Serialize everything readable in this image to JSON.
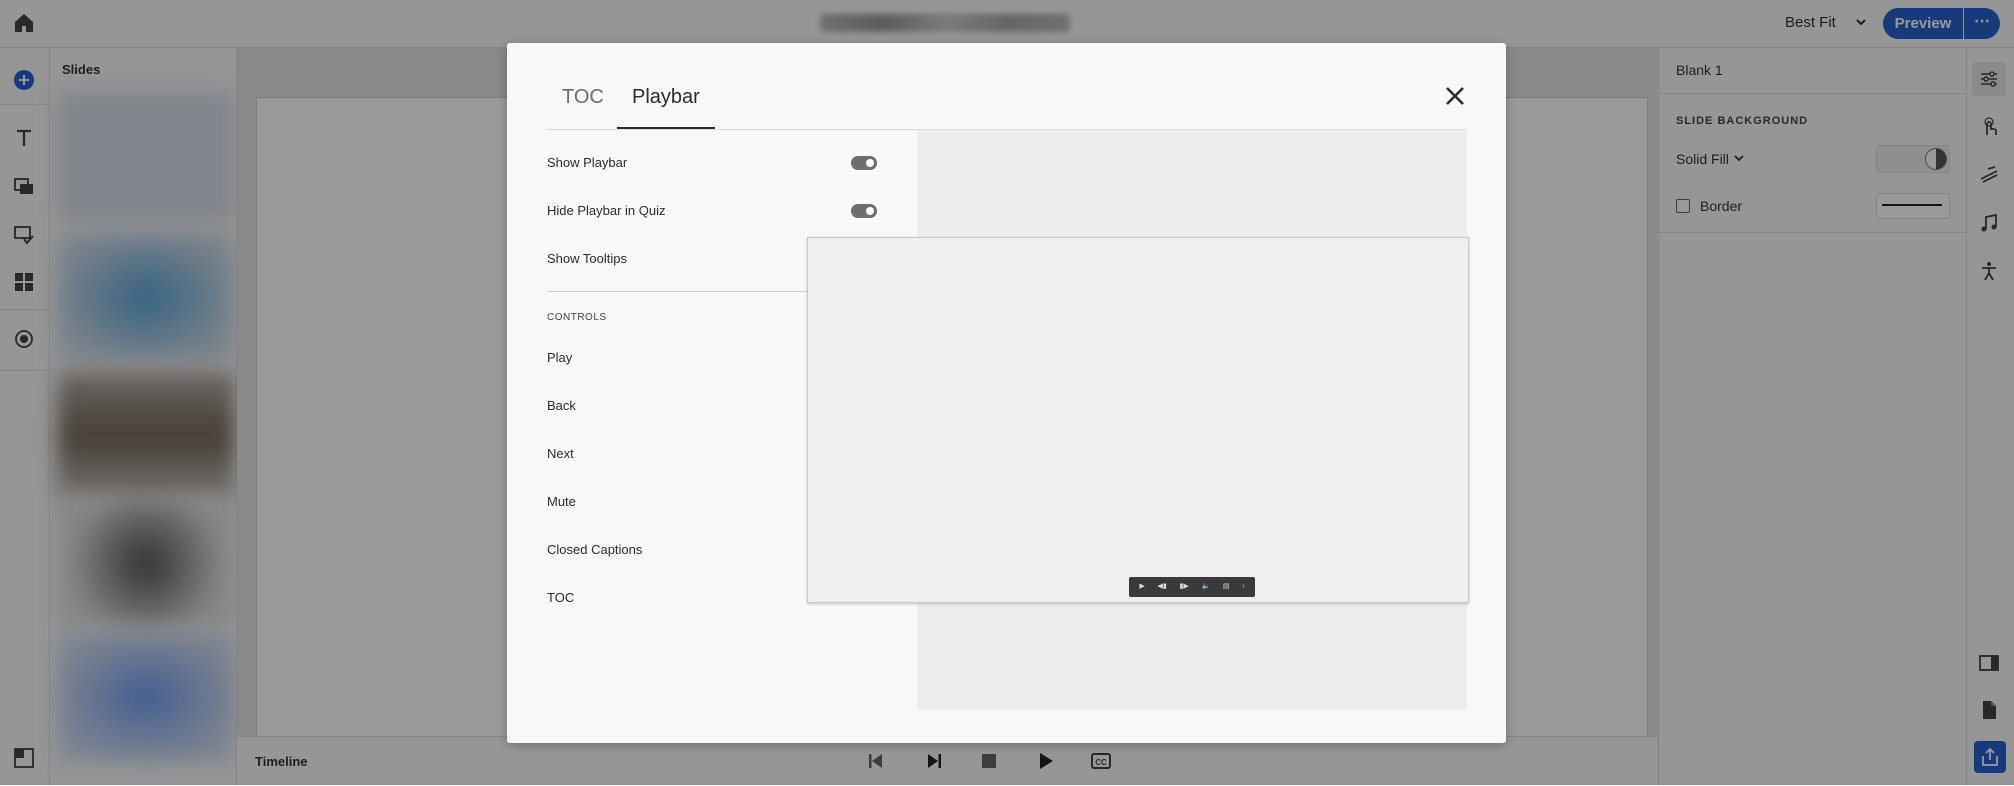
{
  "topbar": {
    "zoom_label": "Best Fit",
    "preview_label": "Preview",
    "more_label": "⋯"
  },
  "slides_panel": {
    "label": "Slides"
  },
  "timeline": {
    "label": "Timeline"
  },
  "properties": {
    "title": "Blank 1",
    "section_label": "SLIDE BACKGROUND",
    "fill_label": "Solid Fill",
    "border_label": "Border"
  },
  "modal": {
    "tabs": [
      {
        "label": "TOC",
        "active": false
      },
      {
        "label": "Playbar",
        "active": true
      }
    ],
    "rows": [
      {
        "label": "Show Playbar",
        "on": true
      },
      {
        "label": "Hide Playbar in Quiz",
        "on": true
      },
      {
        "label": "Show Tooltips"
      }
    ],
    "controls_label": "CONTROLS",
    "controls": [
      "Play",
      "Back",
      "Next",
      "Mute",
      "Closed Captions",
      "TOC"
    ],
    "playbar_preview_glyphs": [
      "▶",
      "◀▮",
      "▮▶",
      "🔈",
      "▤",
      "‹"
    ]
  },
  "colors": {
    "accent": "#2a62cc",
    "toggle": "#6e6e6e"
  }
}
